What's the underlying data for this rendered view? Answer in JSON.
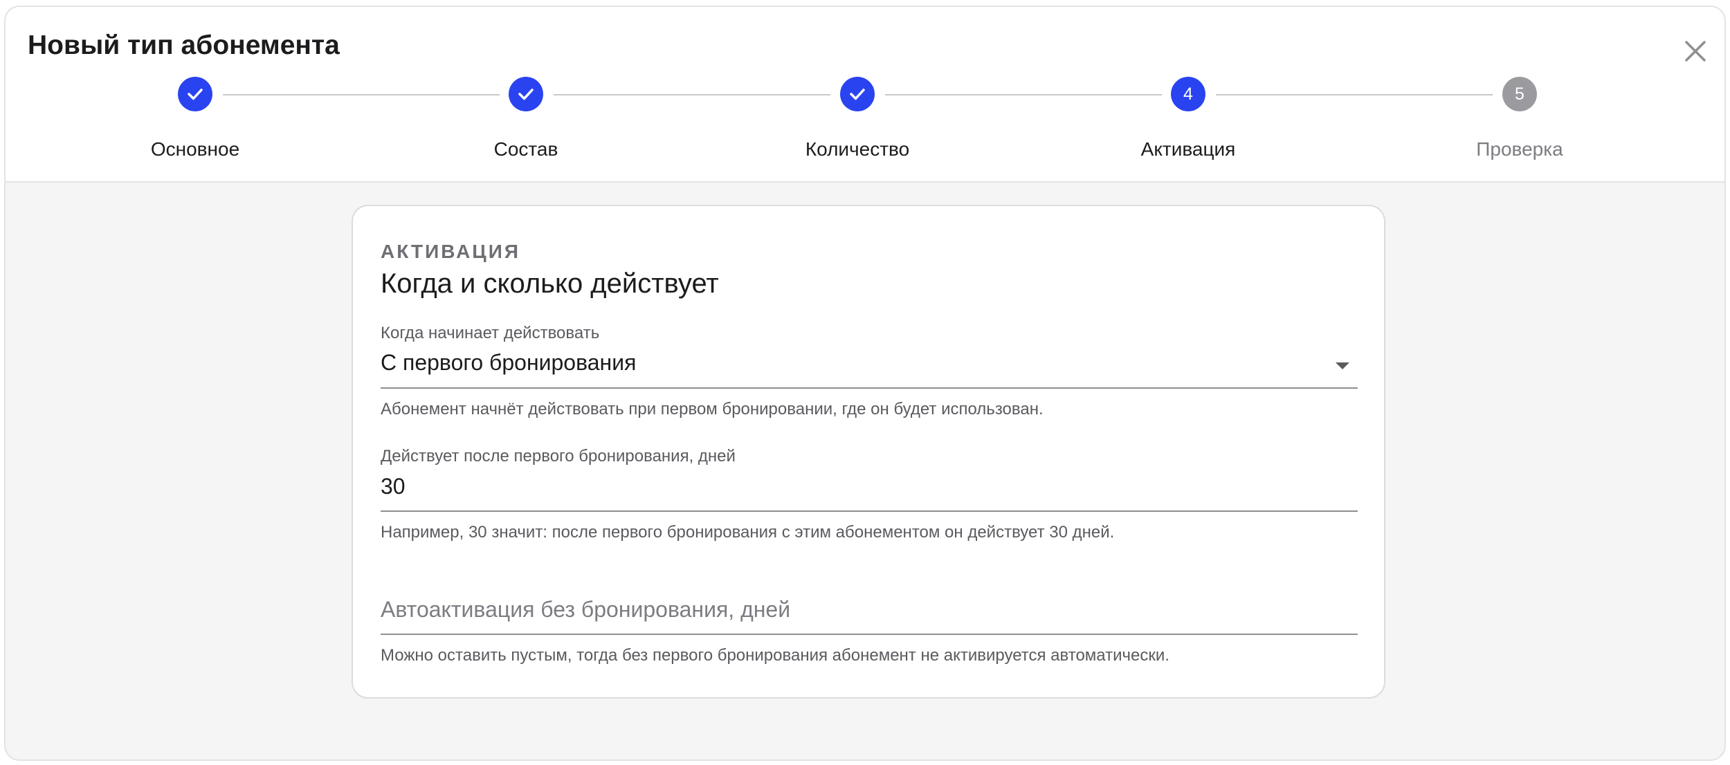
{
  "dialog": {
    "title": "Новый тип абонемента",
    "close_icon": "close-icon"
  },
  "stepper": {
    "steps": [
      {
        "label": "Основное",
        "number": "1",
        "state": "done"
      },
      {
        "label": "Состав",
        "number": "2",
        "state": "done"
      },
      {
        "label": "Количество",
        "number": "3",
        "state": "done"
      },
      {
        "label": "Активация",
        "number": "4",
        "state": "active"
      },
      {
        "label": "Проверка",
        "number": "5",
        "state": "pending"
      }
    ],
    "colors": {
      "active": "#2a43f0",
      "pending": "#9a9a9f"
    }
  },
  "card": {
    "overline": "АКТИВАЦИЯ",
    "title": "Когда и сколько действует",
    "start_field": {
      "label": "Когда начинает действовать",
      "value": "С первого бронирования",
      "helper": "Абонемент начнёт действовать при первом бронировании, где он будет использован."
    },
    "duration_field": {
      "label": "Действует после первого бронирования, дней",
      "value": "30",
      "helper": "Например, 30 значит: после первого бронирования с этим абонементом он действует 30 дней."
    },
    "autoactivation_field": {
      "placeholder": "Автоактивация без бронирования, дней",
      "value": "",
      "helper": "Можно оставить пустым, тогда без первого бронирования абонемент не активируется автоматически."
    }
  }
}
